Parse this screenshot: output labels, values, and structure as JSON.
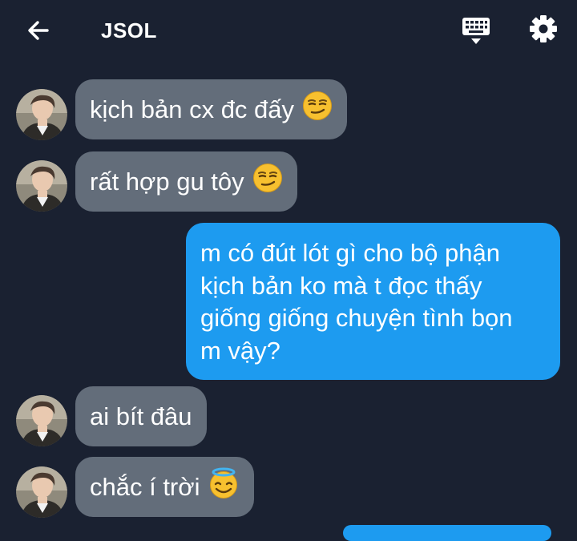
{
  "header": {
    "title": "JSOL",
    "back_icon": "arrow-left-icon",
    "keyboard_icon": "keyboard-icon",
    "settings_icon": "gear-icon"
  },
  "messages": [
    {
      "direction": "incoming",
      "text": "kịch bản cx đc đấy",
      "emoji": "smirking-face-icon"
    },
    {
      "direction": "incoming",
      "text": "rất hợp gu tôy",
      "emoji": "smirking-face-icon"
    },
    {
      "direction": "outgoing",
      "lines": [
        "m có đút lót gì cho bộ phận",
        "kịch bản ko mà t đọc thấy",
        "giống giống chuyện tình bọn",
        "m vậy?"
      ]
    },
    {
      "direction": "incoming",
      "text": "ai bít đâu"
    },
    {
      "direction": "incoming",
      "text": "chắc í trời",
      "emoji": "smiling-face-with-halo-icon"
    }
  ],
  "colors": {
    "background": "#1a2131",
    "incoming_bubble": "#636d7a",
    "outgoing_bubble": "#1d9bf0",
    "text": "#ffffff"
  }
}
